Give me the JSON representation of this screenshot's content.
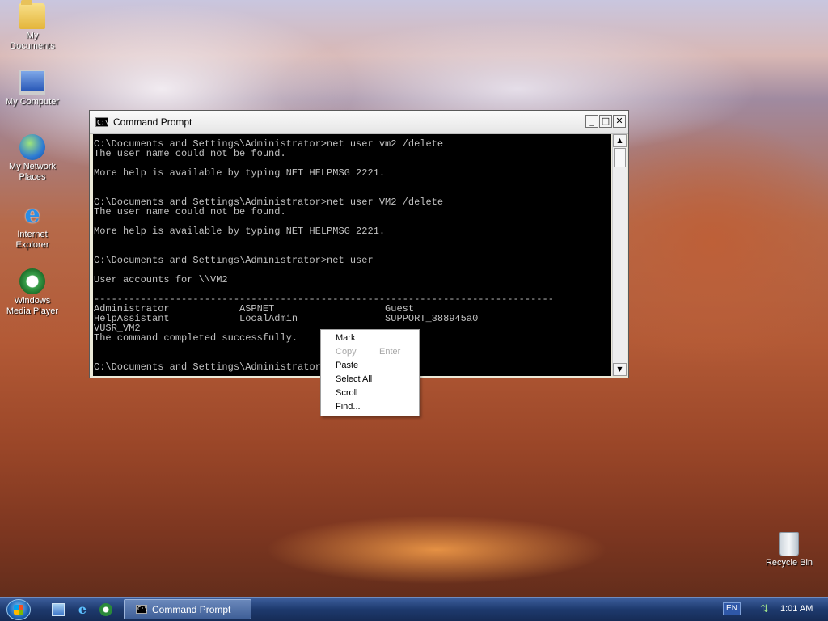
{
  "desktop": {
    "icons": [
      {
        "label_line1": "My",
        "label_line2": "Documents",
        "icon": "folder-icon"
      },
      {
        "label_line1": "My Computer",
        "label_line2": "",
        "icon": "computer-icon"
      },
      {
        "label_line1": "My Network",
        "label_line2": "Places",
        "icon": "network-places-icon"
      },
      {
        "label_line1": "Internet",
        "label_line2": "Explorer",
        "icon": "internet-explorer-icon"
      },
      {
        "label_line1": "Windows",
        "label_line2": "Media Player",
        "icon": "media-player-icon"
      },
      {
        "label_line1": "Recycle Bin",
        "label_line2": "",
        "icon": "recycle-bin-icon"
      }
    ]
  },
  "window": {
    "title": "Command Prompt",
    "buttons": {
      "minimize": "_",
      "maximize": "□",
      "close": "✕"
    },
    "console_lines": [
      "C:\\Documents and Settings\\Administrator>net user vm2 /delete",
      "The user name could not be found.",
      "",
      "More help is available by typing NET HELPMSG 2221.",
      "",
      "",
      "C:\\Documents and Settings\\Administrator>net user VM2 /delete",
      "The user name could not be found.",
      "",
      "More help is available by typing NET HELPMSG 2221.",
      "",
      "",
      "C:\\Documents and Settings\\Administrator>net user",
      "",
      "User accounts for \\\\VM2",
      "",
      "-------------------------------------------------------------------------------",
      "Administrator            ASPNET                   Guest",
      "HelpAssistant            LocalAdmin               SUPPORT_388945a0",
      "VUSR_VM2",
      "The command completed successfully.",
      "",
      "",
      "C:\\Documents and Settings\\Administrator>"
    ],
    "scroll_arrows": {
      "up": "▲",
      "down": "▼"
    }
  },
  "context_menu": {
    "items": [
      {
        "label": "Mark",
        "shortcut": "",
        "enabled": true
      },
      {
        "label": "Copy",
        "shortcut": "Enter",
        "enabled": false
      },
      {
        "label": "Paste",
        "shortcut": "",
        "enabled": true
      },
      {
        "label": "Select All",
        "shortcut": "",
        "enabled": true
      },
      {
        "label": "Scroll",
        "shortcut": "",
        "enabled": true
      },
      {
        "label": "Find...",
        "shortcut": "",
        "enabled": true
      }
    ]
  },
  "taskbar": {
    "task_label": "Command Prompt",
    "language": "EN",
    "clock": "1:01 AM"
  }
}
